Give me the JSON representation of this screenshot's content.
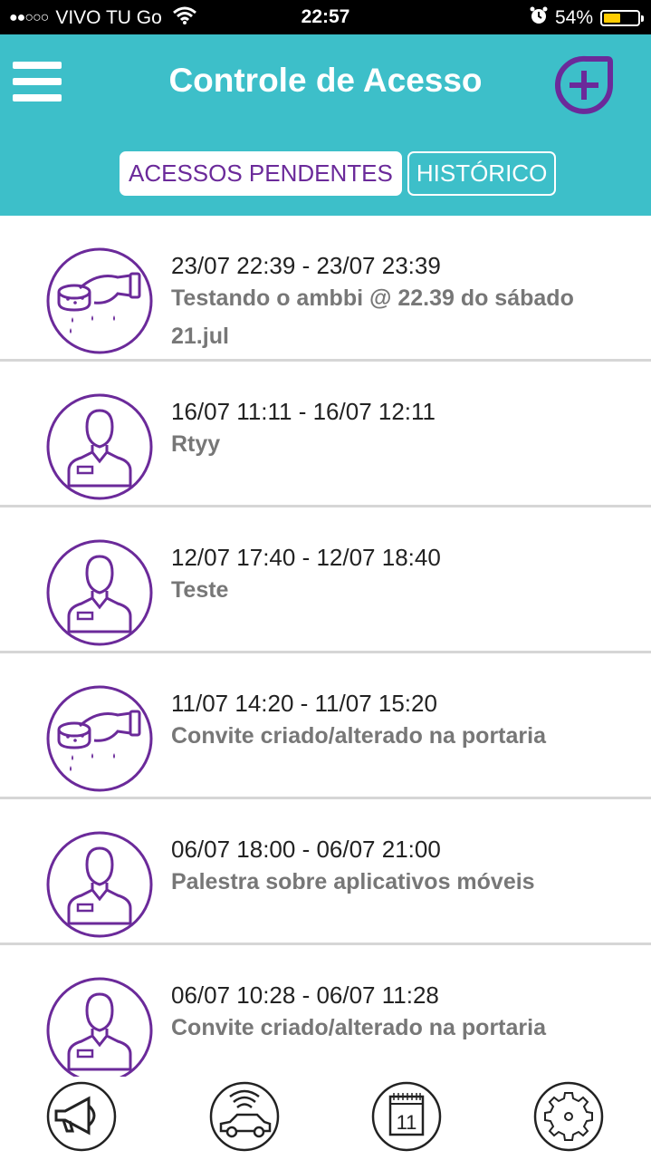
{
  "status_bar": {
    "signal": "●●○○○",
    "carrier": "VIVO TU Go",
    "time": "22:57",
    "battery": "54%",
    "battery_level": 0.54,
    "battery_color": "#ffcc00",
    "icons": [
      "wifi-icon",
      "alarm-icon",
      "battery-icon"
    ]
  },
  "header": {
    "title": "Controle de Acesso",
    "background": "#3dbfc9",
    "accent": "#6b2a9a",
    "menu_icon": "menu-icon",
    "add_icon": "add-access-icon"
  },
  "tabs": [
    {
      "label": "ACESSOS PENDENTES",
      "active": true
    },
    {
      "label": "HISTÓRICO",
      "active": false
    }
  ],
  "items": [
    {
      "icon": "service-cleaning-icon",
      "time": "23/07 22:39 - 23/07 23:39",
      "desc": "Testando o ambbi @ 22.39 do sábado 21.jul"
    },
    {
      "icon": "visitor-person-icon",
      "time": "16/07 11:11 - 16/07 12:11",
      "desc": "Rtyy"
    },
    {
      "icon": "visitor-person-icon",
      "time": "12/07 17:40 - 12/07 18:40",
      "desc": "Teste"
    },
    {
      "icon": "service-cleaning-icon",
      "time": "11/07 14:20 - 11/07 15:20",
      "desc": "Convite criado/alterado na portaria"
    },
    {
      "icon": "visitor-person-icon",
      "time": "06/07 18:00 - 06/07 21:00",
      "desc": "Palestra sobre aplicativos móveis"
    },
    {
      "icon": "visitor-person-icon",
      "time": "06/07 10:28 - 06/07 11:28",
      "desc": "Convite criado/alterado na portaria"
    }
  ],
  "bottom_nav": {
    "items": [
      "megaphone-icon",
      "car-remote-icon",
      "calendar-icon",
      "settings-gear-icon"
    ],
    "calendar_day": "11"
  }
}
